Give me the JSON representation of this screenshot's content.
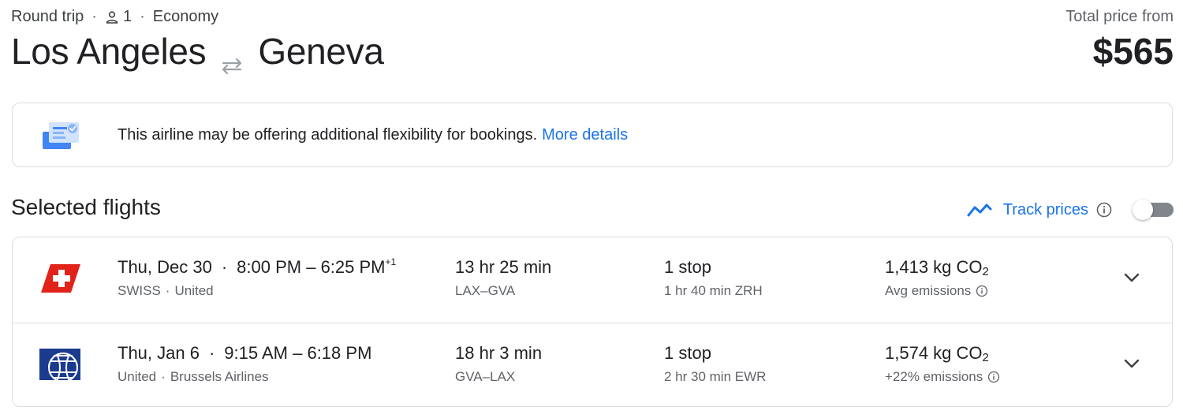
{
  "header": {
    "trip_type": "Round trip",
    "sep": "·",
    "passengers": "1",
    "cabin": "Economy",
    "origin": "Los Angeles",
    "destination": "Geneva",
    "price_label": "Total price from",
    "price": "$565"
  },
  "banner": {
    "text": "This airline may be offering additional flexibility for bookings.",
    "link": "More details"
  },
  "section": {
    "title": "Selected flights",
    "track_label": "Track prices",
    "track_enabled": false
  },
  "flights": [
    {
      "date": "Thu, Dec 30",
      "time_range": "8:00 PM – 6:25 PM",
      "day_offset": "+1",
      "airlines": [
        "SWISS",
        "United"
      ],
      "duration": "13 hr 25 min",
      "route": "LAX–GVA",
      "stops": "1 stop",
      "layover": "1 hr 40 min ZRH",
      "co2_value": "1,413 kg CO",
      "co2_sub": "2",
      "emissions_note": "Avg emissions",
      "logo": "swiss-logo"
    },
    {
      "date": "Thu, Jan 6",
      "time_range": "9:15 AM – 6:18 PM",
      "day_offset": "",
      "airlines": [
        "United",
        "Brussels Airlines"
      ],
      "duration": "18 hr 3 min",
      "route": "GVA–LAX",
      "stops": "1 stop",
      "layover": "2 hr 30 min EWR",
      "co2_value": "1,574 kg CO",
      "co2_sub": "2",
      "emissions_note": "+22% emissions",
      "logo": "united-logo"
    }
  ],
  "colors": {
    "accent": "#1a73e8",
    "text": "#202124",
    "muted": "#5f6368",
    "border": "#dadce0",
    "swiss_red": "#e2231a",
    "united_blue": "#1b3b8f"
  },
  "icons": [
    "person-icon",
    "swap-arrows-icon",
    "booking-flexibility-icon",
    "trend-line-icon",
    "info-icon",
    "chevron-down-icon"
  ]
}
